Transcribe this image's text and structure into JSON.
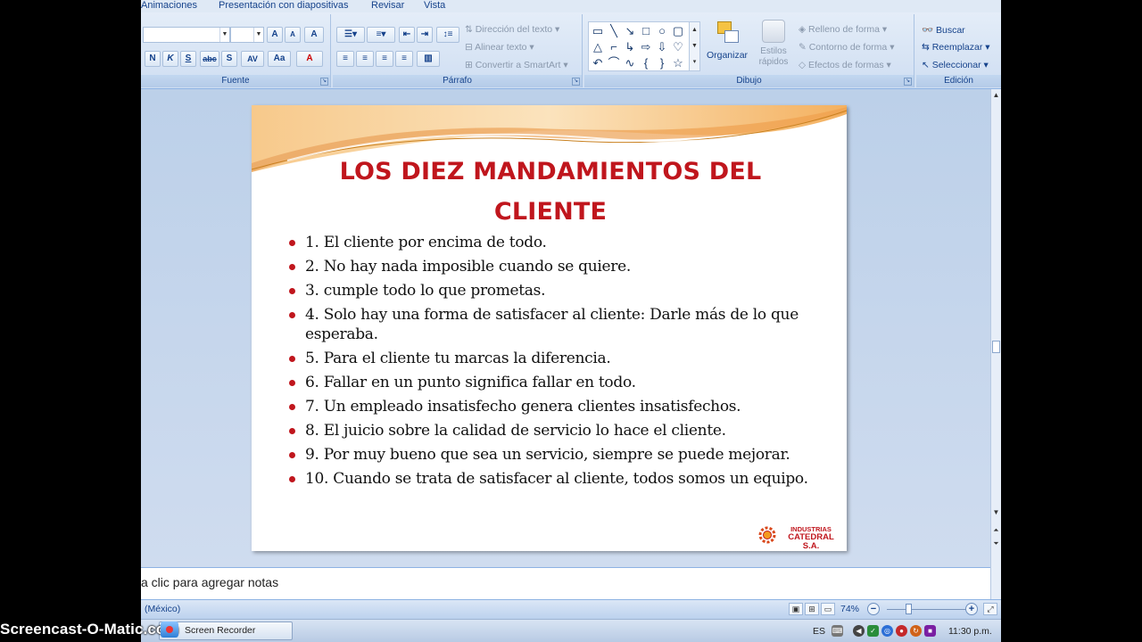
{
  "ribbon_tabs": [
    "Animaciones",
    "Presentación con diapositivas",
    "Revisar",
    "Vista"
  ],
  "font_group": {
    "label": "Fuente",
    "grow_label": "A",
    "shrink_label": "A",
    "clear_label": "A",
    "bold": "N",
    "italic": "K",
    "underline": "S",
    "strike": "abc",
    "shadow": "S",
    "spacing": "AV",
    "case": "Aa",
    "color": "A"
  },
  "paragraph_group": {
    "label": "Párrafo",
    "text_direction": "Dirección del texto",
    "align_text": "Alinear texto",
    "convert_smartart": "Convertir a SmartArt"
  },
  "drawing_group": {
    "label": "Dibujo",
    "arrange": "Organizar",
    "quick_styles_1": "Estilos",
    "quick_styles_2": "rápidos",
    "shape_fill": "Relleno de forma",
    "shape_outline": "Contorno de forma",
    "shape_effects": "Efectos de formas"
  },
  "editing_group": {
    "label": "Edición",
    "find": "Buscar",
    "replace": "Reemplazar",
    "select": "Seleccionar"
  },
  "slide": {
    "title": "LOS DIEZ MANDAMIENTOS DEL CLIENTE",
    "bullets": [
      "1. El cliente por encima de todo.",
      "2. No hay nada imposible cuando se quiere.",
      "3. cumple todo lo que prometas.",
      "4. Solo hay una forma de satisfacer al cliente: Darle más de lo que esperaba.",
      "5. Para el cliente tu marcas la diferencia.",
      "6. Fallar en un punto significa fallar en todo.",
      "7. Un empleado insatisfecho genera clientes insatisfechos.",
      "8. El juicio sobre la calidad de servicio lo hace el cliente.",
      "9. Por muy bueno que sea un servicio, siempre se puede mejorar.",
      "10. Cuando se trata de satisfacer al cliente, todos somos un equipo."
    ],
    "logo_line1": "INDUSTRIAS",
    "logo_line2": "CATEDRAL S.A.",
    "accent_color": "#c0161d"
  },
  "notes_placeholder": "a clic para agregar notas",
  "status": {
    "language": "(México)",
    "zoom": "74%"
  },
  "taskbar": {
    "task_label": "Screen Recorder",
    "lang": "ES",
    "time": "11:30 p.m."
  },
  "watermark": "Screencast-O-Matic.com"
}
